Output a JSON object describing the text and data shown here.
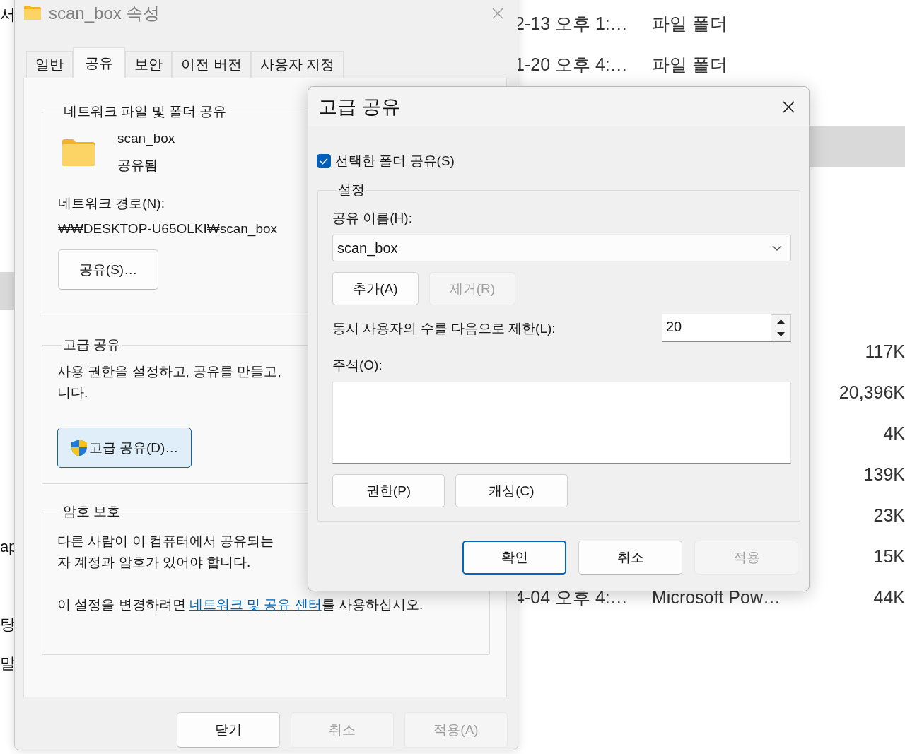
{
  "explorer": {
    "nav_items": [
      {
        "label": "서",
        "selected": false
      },
      {
        "selected": true
      },
      {
        "label": "ap",
        "selected": false
      },
      {
        "label": "탕",
        "selected": false
      },
      {
        "label": "말",
        "selected": false
      }
    ],
    "rows": [
      {
        "date": "2-13 오후 1:…",
        "type": "파일 폴더",
        "selected": false
      },
      {
        "date": "1-20 오후 4:…",
        "type": "파일 폴더",
        "selected": false
      },
      {
        "selected": true
      },
      {
        "size": "117K",
        "selected": false
      },
      {
        "size": "20,396K",
        "selected": false
      },
      {
        "size": "4K",
        "selected": false
      },
      {
        "size": "139K",
        "selected": false
      },
      {
        "size": "23K",
        "selected": false
      },
      {
        "size": "15K",
        "selected": false
      },
      {
        "date": "4-04 오후 4:…",
        "type": "Microsoft Pow…",
        "size": "44K",
        "selected": false
      }
    ]
  },
  "properties": {
    "title": "scan_box 속성",
    "tabs": [
      {
        "label": "일반",
        "selected": false
      },
      {
        "label": "공유",
        "selected": true
      },
      {
        "label": "보안",
        "selected": false
      },
      {
        "label": "이전 버전",
        "selected": false
      },
      {
        "label": "사용자 지정",
        "selected": false
      }
    ],
    "network_group": {
      "title": "네트워크 파일 및 폴더 공유",
      "folder_name": "scan_box",
      "status": "공유됨",
      "path_label": "네트워크 경로(N):",
      "path": "₩₩DESKTOP-U65OLKI₩scan_box",
      "share_button": "공유(S)…"
    },
    "advanced_group": {
      "title": "고급 공유",
      "description_lines": [
        "사용 권한을 설정하고, 공유를 만들고,",
        "니다."
      ],
      "button": {
        "label": "고급 공유(D)…",
        "focused": true
      }
    },
    "password_group": {
      "title": "암호 보호",
      "description_lines": [
        "다른 사람이 이 컴퓨터에서 공유되는",
        "자 계정과 암호가 있어야 합니다."
      ],
      "note_before": "이 설정을 변경하려면 ",
      "link": "네트워크 및 공유 센터",
      "note_after": "를 사용하십시오."
    },
    "buttons": [
      {
        "label": "닫기",
        "disabled": false
      },
      {
        "label": "취소",
        "disabled": true
      },
      {
        "label": "적용(A)",
        "disabled": true
      }
    ]
  },
  "advanced": {
    "title": "고급 공유",
    "share_checkbox": {
      "label": "선택한 폴더 공유(S)",
      "checked": true
    },
    "settings": {
      "title": "설정",
      "share_name_label": "공유 이름(H):",
      "share_name": "scan_box",
      "name_buttons": [
        {
          "label": "추가(A)",
          "disabled": false
        },
        {
          "label": "제거(R)",
          "disabled": true
        }
      ],
      "limit_label": "동시 사용자의 수를 다음으로 제한(L):",
      "limit_value": "20",
      "comment_label": "주석(O):",
      "extra_buttons": [
        {
          "label": "권한(P)",
          "disabled": false
        },
        {
          "label": "캐싱(C)",
          "disabled": false
        }
      ]
    },
    "buttons": [
      {
        "label": "확인",
        "default": true,
        "disabled": false
      },
      {
        "label": "취소",
        "default": false,
        "disabled": false
      },
      {
        "label": "적용",
        "default": false,
        "disabled": true
      }
    ]
  }
}
